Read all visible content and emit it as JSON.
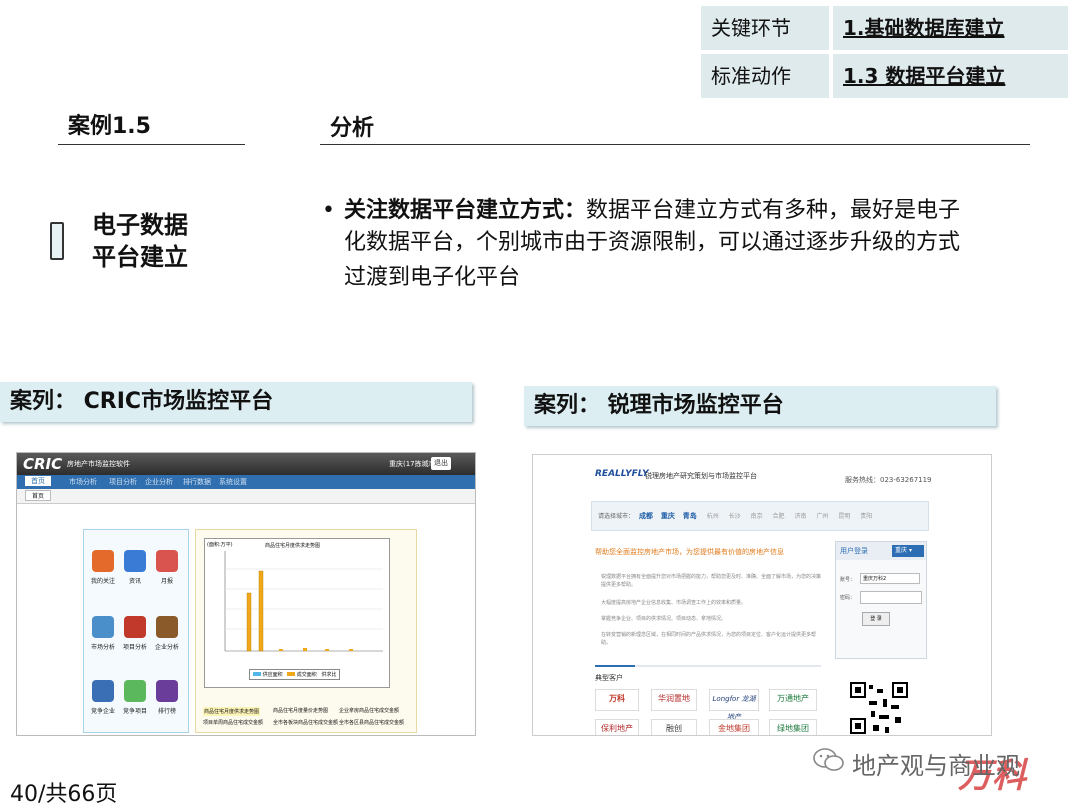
{
  "info_table": {
    "row1_label": "关键环节",
    "row1_value": "1.基础数据库建立",
    "row2_label": "标准动作",
    "row2_value": "1.3  数据平台建立"
  },
  "left_header": "案例1.5",
  "right_header": "分析",
  "topic_line1": "电子数据",
  "topic_line2": "平台建立",
  "bullet": {
    "bold": "关注数据平台建立方式：",
    "line1": "数据平台建立方式有多种，最好是电子",
    "line2": "化数据平台，个别城市由于资源限制，可以通过逐步升级的方式",
    "line3": "过渡到电子化平台"
  },
  "case1_title": "案列： CRIC市场监控平台",
  "case2_title": "案列： 锐理市场监控平台",
  "cric": {
    "logo": "CRIC",
    "title": "房地产市场监控软件",
    "user": "重庆(17拣城市)",
    "exit": "退出",
    "nav": [
      "首页",
      "市场分析",
      "项目分析",
      "企业分析",
      "排行数据",
      "系统设置"
    ],
    "tab": "首页",
    "apps": [
      {
        "label": "我的关注",
        "color": "#e36a2a"
      },
      {
        "label": "资讯",
        "color": "#3a7bd5"
      },
      {
        "label": "月报",
        "color": "#d9534f"
      },
      {
        "label": "市场分析",
        "color": "#4a8fc9"
      },
      {
        "label": "项目分析",
        "color": "#c0392b"
      },
      {
        "label": "企业分析",
        "color": "#8b5a2b"
      },
      {
        "label": "竞争企业",
        "color": "#3b6fb5"
      },
      {
        "label": "竞争项目",
        "color": "#5cb85c"
      },
      {
        "label": "排行榜",
        "color": "#6a3d9a"
      }
    ],
    "chart_title": "商品住宅月度供求走势图",
    "chart_ylabel": "(面积:万平)",
    "chart_legend": [
      "供应面积",
      "成交面积",
      "供求比"
    ],
    "links": [
      "商品住宅月度供求走势图",
      "商品住宅月度量价走势图",
      "企业拿房商品住宅成交金额",
      "项目单周商品住宅成交金额",
      "全市各板块商品住宅成交金额",
      "全市各区县商品住宅成交金额"
    ]
  },
  "reallyfly": {
    "logo": "REALLYFLY",
    "title": "锐理房地产研究策划与市场监控平台",
    "hotline": "服务热线：023-63267119",
    "city_label": "请选择城市：",
    "cities": [
      "成都",
      "重庆",
      "青岛",
      "杭州",
      "长沙",
      "南京",
      "合肥",
      "济南",
      "广州",
      "昆明",
      "贵阳"
    ],
    "headline": "帮助您全面监控房地产市场，为您提供最有价值的房地产信息",
    "desc": [
      "锐理数据平台拥有全面提升您对市场把握的能力，帮助您更及时、准确、全面了解市场，为您的决策提供更多帮助。",
      "大幅度提高房地产企业信息收集、市场调查工作上的效率和质量。",
      "掌握竞争企业、项目的供求情况、项目动态、拿地情况。",
      "在转变营销的新理念区域，在相同时间的产品供求情况，为您的项目定位、客户化运计提供更多帮助。"
    ],
    "login_title": "用户登录",
    "login_city": "重庆",
    "account_label": "账号：",
    "account_value": "重庆万科2",
    "password_label": "密码：",
    "login_button": "登 录",
    "clients_title": "典型客户",
    "clients": [
      "万科",
      "华润置地",
      "Longfor 龙湖地产",
      "万通地产",
      "保利地产",
      "融创",
      "金地集团",
      "绿地集团"
    ]
  },
  "page_number": "40/共66页",
  "watermark": "地产观与商业观",
  "watermark_logo": "万科"
}
